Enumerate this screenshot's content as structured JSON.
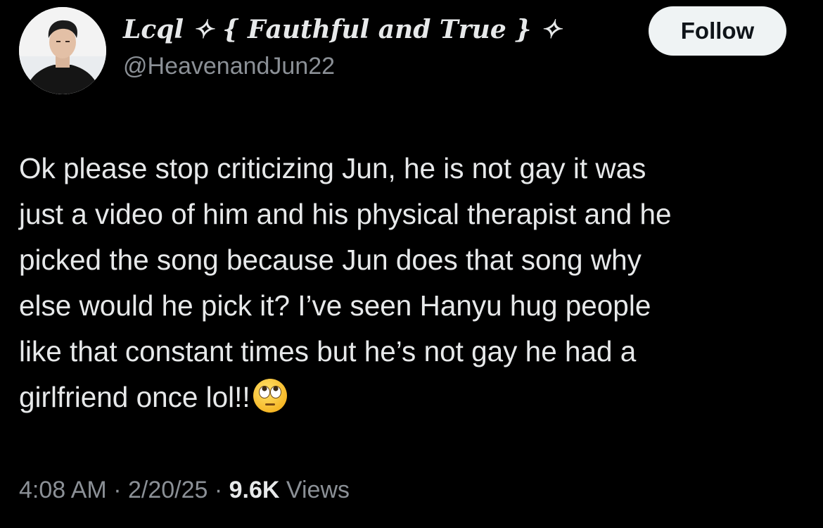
{
  "author": {
    "display_name": "Lcql ✧ { 𝑭𝒂𝒖𝒕𝒉𝒇𝒖𝒍 𝒂𝒏𝒅 𝑻𝒓𝒖𝒆 } ✧",
    "handle": "@HeavenandJun22",
    "avatar_icon": "profile-photo-avatar"
  },
  "follow_button": {
    "label": "Follow"
  },
  "tweet": {
    "lines": [
      "Ok please stop criticizing Jun, he is not gay it was",
      "just a video of him and his physical therapist and he",
      "picked the song because Jun does that song why",
      "else would he pick it? I’ve seen Hanyu hug people",
      "like that constant times but he’s not gay he had a",
      "girlfriend once lol!!"
    ],
    "trailing_emoji": "face-with-rolling-eyes-icon"
  },
  "meta": {
    "time": "4:08 AM",
    "separator": " · ",
    "date": "2/20/25",
    "views_count": "9.6K",
    "views_label": " Views"
  },
  "colors": {
    "background": "#000000",
    "text_primary": "#e7e9ea",
    "text_secondary": "#8b9096",
    "button_background": "#eff3f4",
    "button_text": "#0f1419"
  }
}
